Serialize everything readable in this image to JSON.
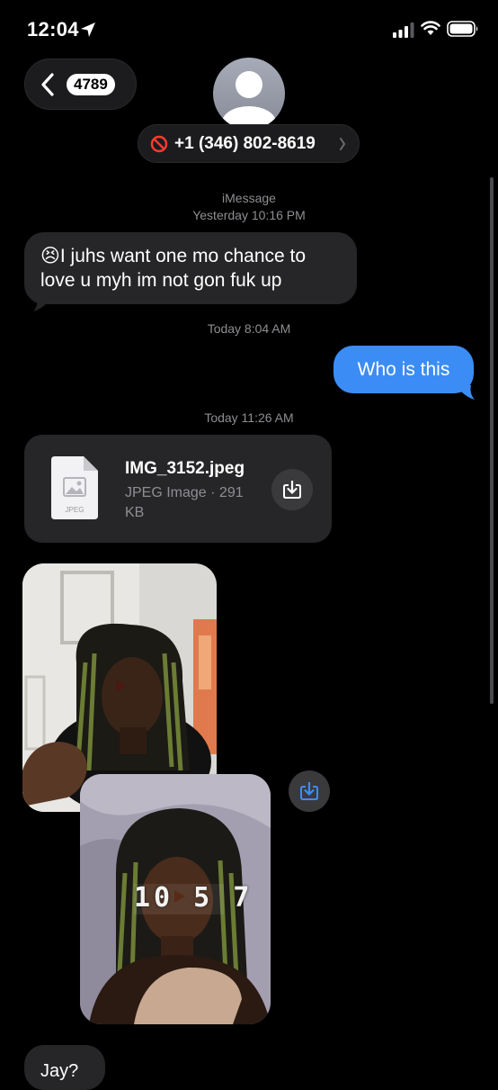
{
  "status_bar": {
    "time": "12:04",
    "icons": [
      "location-arrow-icon",
      "cellular-signal-icon",
      "wifi-icon",
      "battery-icon"
    ]
  },
  "header": {
    "back_badge": "4789",
    "contact_number": "+1 (346) 802-8619",
    "contact_status_icon": "blocked-icon"
  },
  "thread": {
    "service_label": "iMessage",
    "timestamp_1": "Yesterday 10:16 PM",
    "message_1": "😣I juhs want one mo chance to love u myh im not gon fuk up",
    "timestamp_2": "Today 8:04 AM",
    "message_2": "Who is this",
    "timestamp_3": "Today 11:26 AM",
    "attachment": {
      "name": "IMG_3152.jpeg",
      "meta": "JPEG Image · 291 KB",
      "thumb_label": "JPEG"
    },
    "video_overlay": "10 5 7",
    "message_3": "Jay?"
  },
  "colors": {
    "background": "#000000",
    "incoming_bubble": "#262628",
    "outgoing_bubble": "#3b8df5",
    "secondary_text": "#8e8e93",
    "blocked_red": "#ff3b30"
  }
}
